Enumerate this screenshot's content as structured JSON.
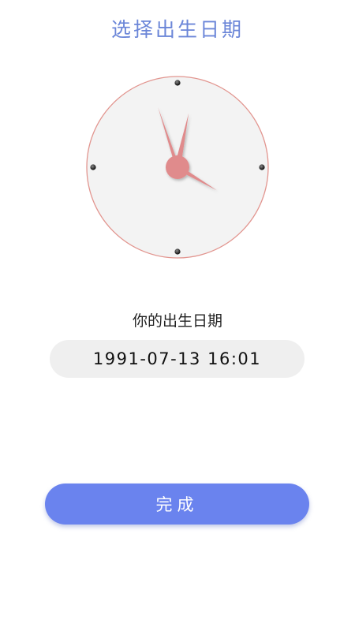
{
  "header": {
    "title": "选择出生日期"
  },
  "clock": {
    "icon": "analog-clock",
    "time": "16:01",
    "hour": 16,
    "minute": 1,
    "second": 57,
    "colors": {
      "hands": "#e08b8c",
      "rim": "#e2958f",
      "face": "#f3f3f3",
      "markers": "#222222"
    }
  },
  "birth": {
    "label": "你的出生日期",
    "value": "1991-07-13 16:01"
  },
  "actions": {
    "done_label": "完成"
  },
  "theme": {
    "accent": "#6a83ee",
    "title_color": "#6b86d8",
    "field_bg": "#efefef"
  }
}
